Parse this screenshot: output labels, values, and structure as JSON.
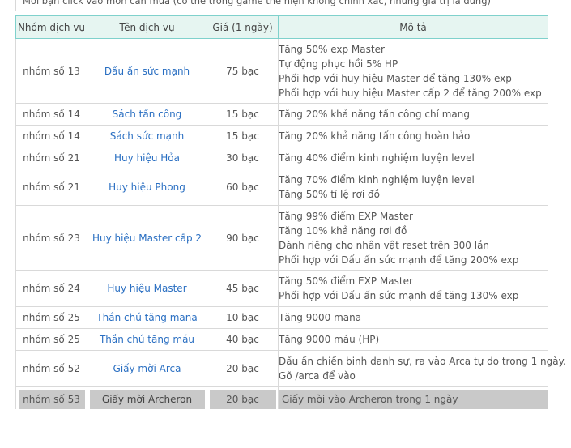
{
  "notice": "Mời bạn click vào món cần mua (có thể trong game thể hiện không chính xác, nhưng giá trị là đúng)",
  "headers": [
    "Nhóm dịch vụ",
    "Tên dịch vụ",
    "Giá (1 ngày)",
    "Mô tả"
  ],
  "rows": [
    {
      "group": "nhóm số 13",
      "name": "Dấu ấn sức mạnh",
      "price": "75 bạc",
      "desc": [
        "Tăng 50% exp Master",
        "Tự động phục hồi 5% HP",
        "Phối hợp với huy hiệu Master để tăng 130% exp",
        "Phối hợp với huy hiệu Master cấp 2 để tăng 200% exp"
      ]
    },
    {
      "group": "nhóm số 14",
      "name": "Sách tấn công",
      "price": "15 bạc",
      "desc": [
        "Tăng 20% khả năng tấn công chí mạng"
      ]
    },
    {
      "group": "nhóm số 14",
      "name": "Sách sức mạnh",
      "price": "15 bạc",
      "desc": [
        "Tăng 20% khả năng tấn công hoàn hảo"
      ]
    },
    {
      "group": "nhóm số 21",
      "name": "Huy hiệu Hỏa",
      "price": "30 bạc",
      "desc": [
        "Tăng 40% điểm kinh nghiệm luyện level"
      ]
    },
    {
      "group": "nhóm số 21",
      "name": "Huy hiệu Phong",
      "price": "60 bạc",
      "desc": [
        "Tăng 70% điểm kinh nghiệm luyện level",
        "Tăng 50% tỉ lệ rơi đồ"
      ]
    },
    {
      "group": "nhóm số 23",
      "name": "Huy hiệu Master cấp 2",
      "price": "90 bạc",
      "desc": [
        "Tăng 99% điểm EXP Master",
        "Tăng 10% khả năng rơi đồ",
        "Dành riêng cho nhân vật reset trên 300 lần",
        "Phối hợp với Dấu ấn sức mạnh để tăng 200% exp"
      ]
    },
    {
      "group": "nhóm số 24",
      "name": "Huy hiệu Master",
      "price": "45 bạc",
      "desc": [
        "Tăng 50% điểm EXP Master",
        "Phối hợp với Dấu ấn sức mạnh để tăng 130% exp"
      ]
    },
    {
      "group": "nhóm số 25",
      "name": "Thần chú tăng mana",
      "price": "10 bạc",
      "desc": [
        "Tăng 9000 mana"
      ]
    },
    {
      "group": "nhóm số 25",
      "name": "Thần chú tăng máu",
      "price": "40 bạc",
      "desc": [
        "Tăng 9000 máu (HP)"
      ]
    },
    {
      "group": "nhóm số 52",
      "name": "Giấy mời Arca",
      "price": "20 bạc",
      "desc": [
        "Dấu ấn chiến binh danh sự, ra vào Arca tự do trong 1 ngày.",
        "Gõ /arca để vào"
      ]
    },
    {
      "group": "nhóm số 53",
      "name": "Giấy mời Archeron",
      "price": "20 bạc",
      "desc": [
        "Giấy mời vào Archeron trong 1 ngày"
      ],
      "selected": true
    }
  ]
}
